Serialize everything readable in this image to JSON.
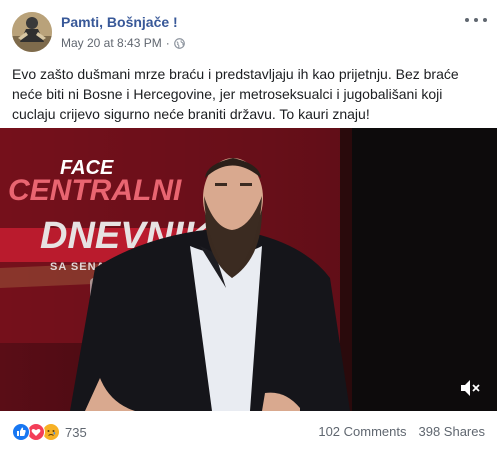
{
  "post": {
    "page_name": "Pamti, Bošnjače !",
    "timestamp": "May 20 at 8:43 PM",
    "separator": "·",
    "text": "Evo zašto dušmani mrze braću i predstavljaju ih kao prijetnju. Bez braće neće biti ni Bosne i Hercegovine, jer metroseksualci i jugobališani koji cuclaju crijevo sigurno neće braniti državu. To kauri znaju!"
  },
  "video": {
    "channel_logo": "FACE",
    "banner_line1": "CENTRALNI",
    "banner_line2": "DNEVNIK",
    "banner_line3": "SA SENADOM H"
  },
  "footer": {
    "reaction_count": "735",
    "comments": "102 Comments",
    "shares": "398 Shares"
  },
  "icons": {
    "reactions": [
      "like-icon",
      "love-icon",
      "sad-icon"
    ],
    "privacy": "globe-icon",
    "video_control": "volume-muted-icon"
  },
  "colors": {
    "link": "#385898",
    "meta": "#616770",
    "like": "#1877f2",
    "love": "#f33e58",
    "sad": "#f7b125",
    "banner_red": "#d1253a"
  }
}
